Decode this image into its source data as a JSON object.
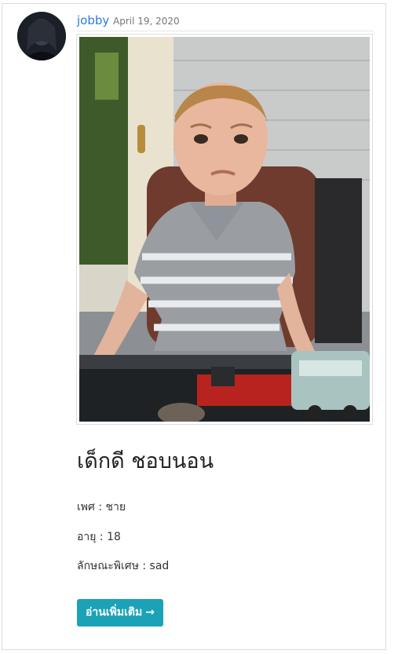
{
  "post": {
    "author": "jobby",
    "date": "April 19, 2020",
    "title": "เด็กดี ชอบนอน",
    "fields": [
      {
        "label": "เพศ",
        "value": "ชาย"
      },
      {
        "label": "อายุ",
        "value": "18"
      },
      {
        "label": "ลักษณะพิเศษ",
        "value": "sad"
      }
    ],
    "read_more_label": "อ่านเพิ่มเติม",
    "read_more_arrow": "→"
  },
  "colors": {
    "author_link": "#2a7ae2",
    "button": "#1ba2b7"
  }
}
